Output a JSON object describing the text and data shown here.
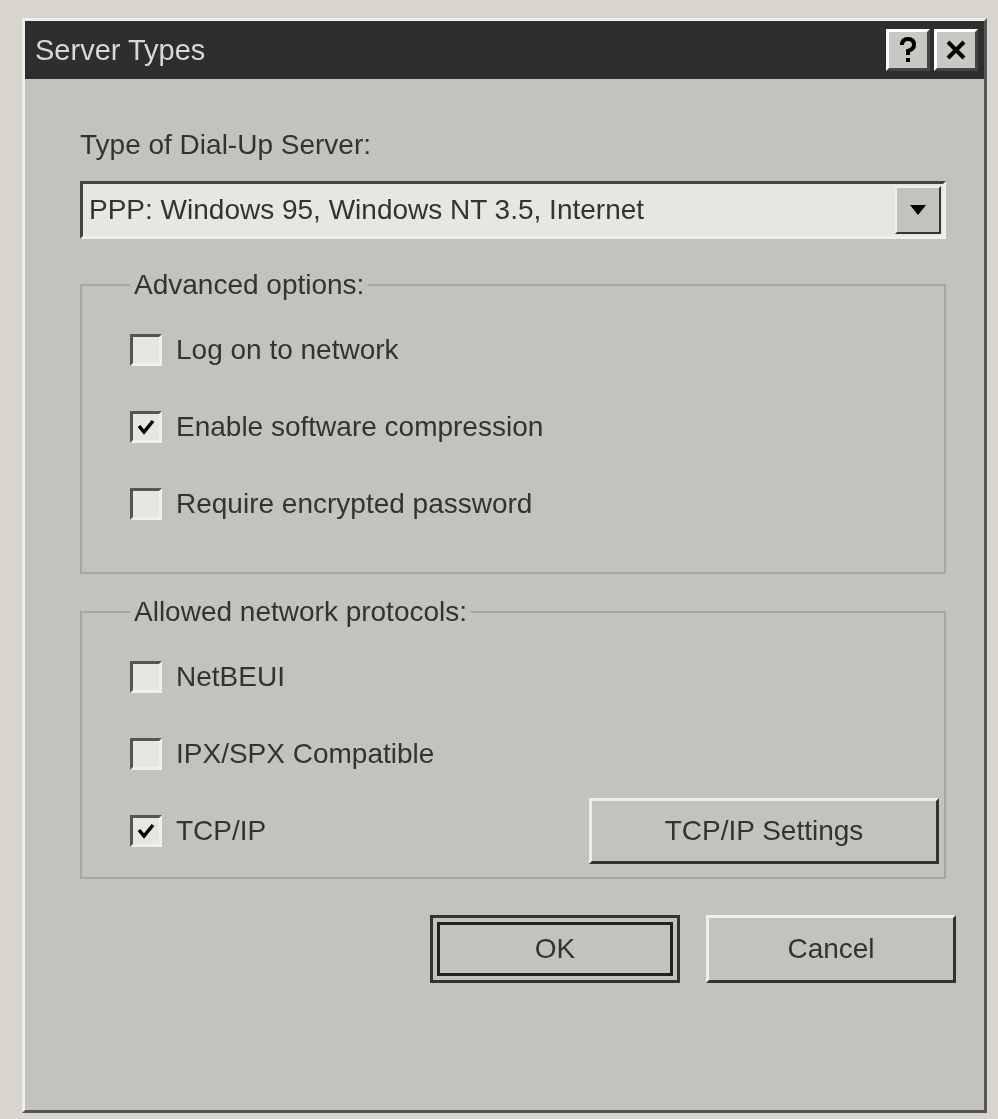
{
  "window": {
    "title": "Server Types"
  },
  "server_type": {
    "label": "Type of Dial-Up Server:",
    "value": "PPP: Windows 95, Windows NT 3.5, Internet"
  },
  "advanced_options": {
    "label": "Advanced options:",
    "options": [
      {
        "label": "Log on to network",
        "checked": false
      },
      {
        "label": "Enable software compression",
        "checked": true
      },
      {
        "label": "Require encrypted password",
        "checked": false
      }
    ]
  },
  "protocols": {
    "label": "Allowed network protocols:",
    "options": [
      {
        "label": "NetBEUI",
        "checked": false
      },
      {
        "label": "IPX/SPX Compatible",
        "checked": false
      },
      {
        "label": "TCP/IP",
        "checked": true
      }
    ],
    "settings_button": "TCP/IP Settings"
  },
  "buttons": [
    {
      "label": "OK",
      "default": true
    },
    {
      "label": "Cancel",
      "default": false
    }
  ]
}
